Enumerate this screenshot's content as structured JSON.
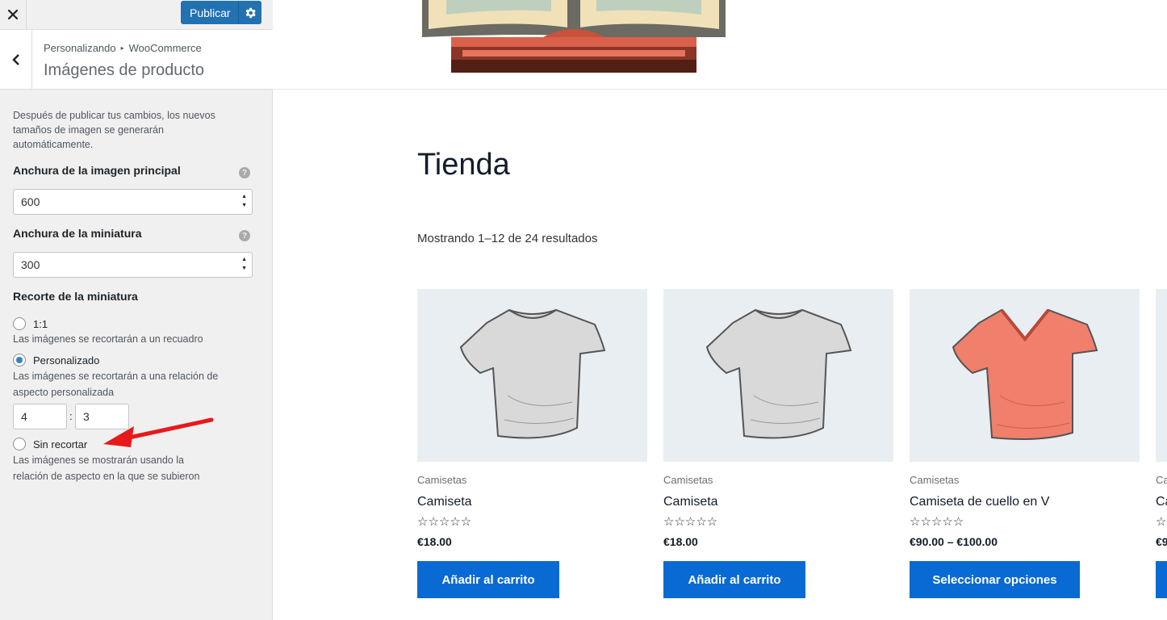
{
  "topbar": {
    "close_icon": "close-icon",
    "publish_label": "Publicar",
    "settings_icon": "gear-icon"
  },
  "section": {
    "breadcrumb_parent": "Personalizando",
    "breadcrumb_separator": "▸",
    "breadcrumb_current": "WooCommerce",
    "title": "Imágenes de producto"
  },
  "controls": {
    "intro": "Después de publicar tus cambios, los nuevos tamaños de imagen se generarán automáticamente.",
    "main_width_label": "Anchura de la imagen principal",
    "main_width_value": "600",
    "thumb_width_label": "Anchura de la miniatura",
    "thumb_width_value": "300",
    "crop_label": "Recorte de la miniatura",
    "help_glyph": "?",
    "crop_options": [
      {
        "label": "1:1",
        "description": "Las imágenes se recortarán a un recuadro",
        "checked": false
      },
      {
        "label": "Personalizado",
        "description": "Las imágenes se recortarán a una relación de aspecto personalizada",
        "checked": true
      },
      {
        "label": "Sin recortar",
        "description": "Las imágenes se mostrarán usando la relación de aspecto en la que se subieron",
        "checked": false
      }
    ],
    "ratio_width": "4",
    "ratio_separator": ":",
    "ratio_height": "3"
  },
  "shop": {
    "title": "Tienda",
    "result_count": "Mostrando 1–12 de 24 resultados",
    "products": [
      {
        "category": "Camisetas",
        "name": "Camiseta",
        "rating_stars": "☆☆☆☆☆",
        "price": "€18.00",
        "button": "Añadir al carrito",
        "shirt_color": "#d9d9d9"
      },
      {
        "category": "Camisetas",
        "name": "Camiseta",
        "rating_stars": "☆☆☆☆☆",
        "price": "€18.00",
        "button": "Añadir al carrito",
        "shirt_color": "#d9d9d9"
      },
      {
        "category": "Camisetas",
        "name": "Camiseta de cuello en V",
        "rating_stars": "☆☆☆☆☆",
        "price": "€90.00 – €100.00",
        "button": "Seleccionar opciones",
        "shirt_color": "#f07f6b"
      },
      {
        "category": "Ca",
        "name": "Ca",
        "rating_stars": "☆",
        "price": "€9",
        "button": "",
        "shirt_color": "#e9eef2"
      }
    ]
  },
  "colors": {
    "accent": "#2271b1",
    "shop_button": "#0a6ad3",
    "annotation_arrow": "#e8191a"
  }
}
